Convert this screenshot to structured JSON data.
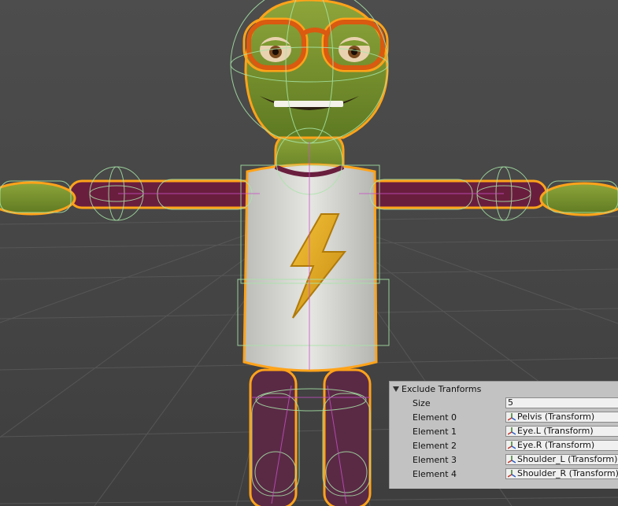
{
  "inspector": {
    "title": "Exclude Tranforms",
    "size_label": "Size",
    "size_value": "5",
    "elements": [
      {
        "label": "Element 0",
        "value": "Pelvis (Transform)"
      },
      {
        "label": "Element 1",
        "value": "Eye.L (Transform)"
      },
      {
        "label": "Element 2",
        "value": "Eye.R (Transform)"
      },
      {
        "label": "Element 3",
        "value": "Shoulder_L (Transform)"
      },
      {
        "label": "Element 4",
        "value": "Shoulder_R (Transform)"
      }
    ]
  },
  "icons": {
    "foldout": "triangle-down-icon",
    "transform": "transform-axes-icon"
  },
  "colors": {
    "selection_outline": "#ffa31a",
    "collider_gizmo": "#a8e6a8",
    "inspector_bg": "#c2c2c2",
    "viewport_bg": "#4a4a4a"
  }
}
